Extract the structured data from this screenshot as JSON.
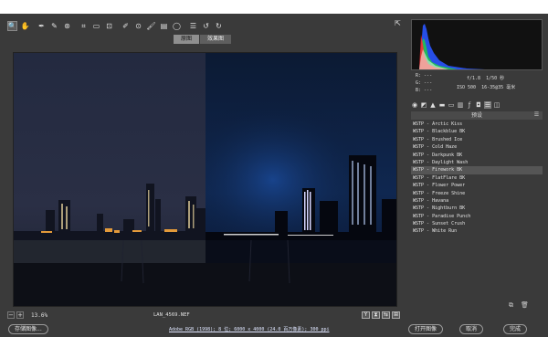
{
  "toolbar": {
    "tools": [
      {
        "name": "zoom-icon",
        "glyph": "🔍"
      },
      {
        "name": "hand-icon",
        "glyph": "✋"
      },
      {
        "name": "white-balance-icon",
        "glyph": "✒"
      },
      {
        "name": "color-sampler-icon",
        "glyph": "✎"
      },
      {
        "name": "targeted-adjust-icon",
        "glyph": "⊛"
      },
      {
        "name": "crop-icon",
        "glyph": "⌗"
      },
      {
        "name": "straighten-icon",
        "glyph": "▭"
      },
      {
        "name": "transform-icon",
        "glyph": "⊡"
      },
      {
        "name": "spot-removal-icon",
        "glyph": "✐"
      },
      {
        "name": "red-eye-icon",
        "glyph": "⊙"
      },
      {
        "name": "adjustment-brush-icon",
        "glyph": "🖌"
      },
      {
        "name": "graduated-filter-icon",
        "glyph": "▤"
      },
      {
        "name": "radial-filter-icon",
        "glyph": "◯"
      },
      {
        "name": "preferences-icon",
        "glyph": "☰"
      },
      {
        "name": "rotate-left-icon",
        "glyph": "↺"
      },
      {
        "name": "rotate-right-icon",
        "glyph": "↻"
      }
    ],
    "export_glyph": "⇱"
  },
  "view_tabs": [
    "原图",
    "效果图"
  ],
  "bottom": {
    "zoom_out": "−",
    "zoom_in": "+",
    "zoom": "13.6%",
    "filename": "LAN_4569.NEF",
    "view_buttons": [
      "Y",
      "⧗",
      "⇆",
      "⊞"
    ]
  },
  "readout": {
    "r_label": "R:",
    "r_value": "---",
    "g_label": "G:",
    "g_value": "---",
    "b_label": "B:",
    "b_value": "---",
    "aperture": "f/1.8",
    "shutter": "1/50 秒",
    "iso": "ISO 500",
    "focal": "16-35@35 毫米"
  },
  "panel": {
    "title": "预设",
    "presets": [
      "WSTP - Arctic Kiss",
      "WSTP - Blackblue BK",
      "WSTP - Brushed Ice",
      "WSTP - Cold Haze",
      "WSTP - Darkpunk BK",
      "WSTP - Daylight Wash",
      "WSTP - Firework BK",
      "WSTP - FlatFlare BK",
      "WSTP - Flower Power",
      "WSTP - Freeze Shine",
      "WSTP - Havana",
      "WSTP - Nightburn BK",
      "WSTP - Paradise Punch",
      "WSTP - Sunset Crush",
      "WSTP - White Run"
    ],
    "selected_index": 6
  },
  "footer": {
    "save_label": "存储图像...",
    "info": "Adobe RGB (1998); 8 位; 6000 x 4000 (24.0 百万像素); 300 ppi",
    "open_label": "打开图像",
    "cancel_label": "取消",
    "done_label": "完成"
  }
}
